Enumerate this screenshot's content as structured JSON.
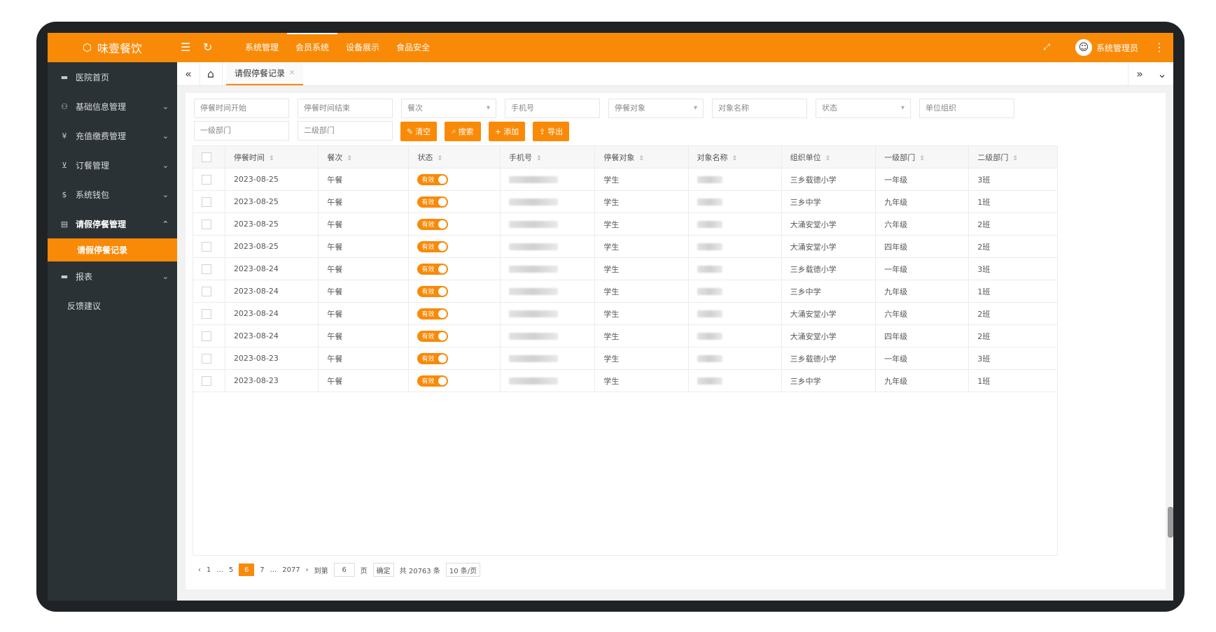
{
  "app": {
    "title": "味壹餐饮"
  },
  "topnav": {
    "items": [
      {
        "label": "系统管理",
        "active": false
      },
      {
        "label": "会员系统",
        "active": true
      },
      {
        "label": "设备展示",
        "active": false
      },
      {
        "label": "食品安全",
        "active": false
      }
    ],
    "user_name": "系统管理员"
  },
  "sidebar": {
    "items": [
      {
        "label": "医院首页",
        "icon": "monitor-icon"
      },
      {
        "label": "基础信息管理",
        "icon": "user-icon",
        "chevron": true
      },
      {
        "label": "充值缴费管理",
        "icon": "yen-icon",
        "chevron": true
      },
      {
        "label": "订餐管理",
        "icon": "cart-icon",
        "chevron": true
      },
      {
        "label": "系统钱包",
        "icon": "dollar-icon",
        "chevron": true
      },
      {
        "label": "请假停餐管理",
        "icon": "calendar-icon",
        "chevron": true,
        "open": true
      }
    ],
    "sub_active": "请假停餐记录",
    "after": [
      {
        "label": "报表",
        "icon": "monitor-icon",
        "chevron": true
      }
    ],
    "plain": "反馈建议"
  },
  "tabs": {
    "active": "请假停餐记录"
  },
  "filters": {
    "row1": [
      "停餐时间开始",
      "停餐时间结束",
      "餐次",
      "手机号",
      "停餐对象",
      "对象名称",
      "状态",
      "单位组织"
    ],
    "row2": [
      "一级部门",
      "二级部门"
    ],
    "buttons": {
      "clear": "清空",
      "search": "搜索",
      "add": "添加",
      "export": "导出"
    }
  },
  "table": {
    "headers": [
      "停餐时间",
      "餐次",
      "状态",
      "手机号",
      "停餐对象",
      "对象名称",
      "组织单位",
      "一级部门",
      "二级部门"
    ],
    "rows": [
      [
        "2023-08-25",
        "午餐",
        "有效",
        "学生",
        "三乡载德小学",
        "一年级",
        "3班"
      ],
      [
        "2023-08-25",
        "午餐",
        "有效",
        "学生",
        "三乡中学",
        "九年级",
        "1班"
      ],
      [
        "2023-08-25",
        "午餐",
        "有效",
        "学生",
        "大涌安堂小学",
        "六年级",
        "2班"
      ],
      [
        "2023-08-25",
        "午餐",
        "有效",
        "学生",
        "大涌安堂小学",
        "四年级",
        "2班"
      ],
      [
        "2023-08-24",
        "午餐",
        "有效",
        "学生",
        "三乡载德小学",
        "一年级",
        "3班"
      ],
      [
        "2023-08-24",
        "午餐",
        "有效",
        "学生",
        "三乡中学",
        "九年级",
        "1班"
      ],
      [
        "2023-08-24",
        "午餐",
        "有效",
        "学生",
        "大涌安堂小学",
        "六年级",
        "2班"
      ],
      [
        "2023-08-24",
        "午餐",
        "有效",
        "学生",
        "大涌安堂小学",
        "四年级",
        "2班"
      ],
      [
        "2023-08-23",
        "午餐",
        "有效",
        "学生",
        "三乡载德小学",
        "一年级",
        "3班"
      ],
      [
        "2023-08-23",
        "午餐",
        "有效",
        "学生",
        "三乡中学",
        "九年级",
        "1班"
      ]
    ]
  },
  "pager": {
    "pages": [
      "1",
      "...",
      "5",
      "6",
      "7",
      "...",
      "2077"
    ],
    "current": "6",
    "goto_label": "到第",
    "goto_value": "6",
    "page_unit": "页",
    "confirm": "确定",
    "total": "共 20763 条",
    "per_page": "10 条/页"
  },
  "colors": {
    "accent": "#f98a08",
    "sidebar": "#2b3236"
  }
}
